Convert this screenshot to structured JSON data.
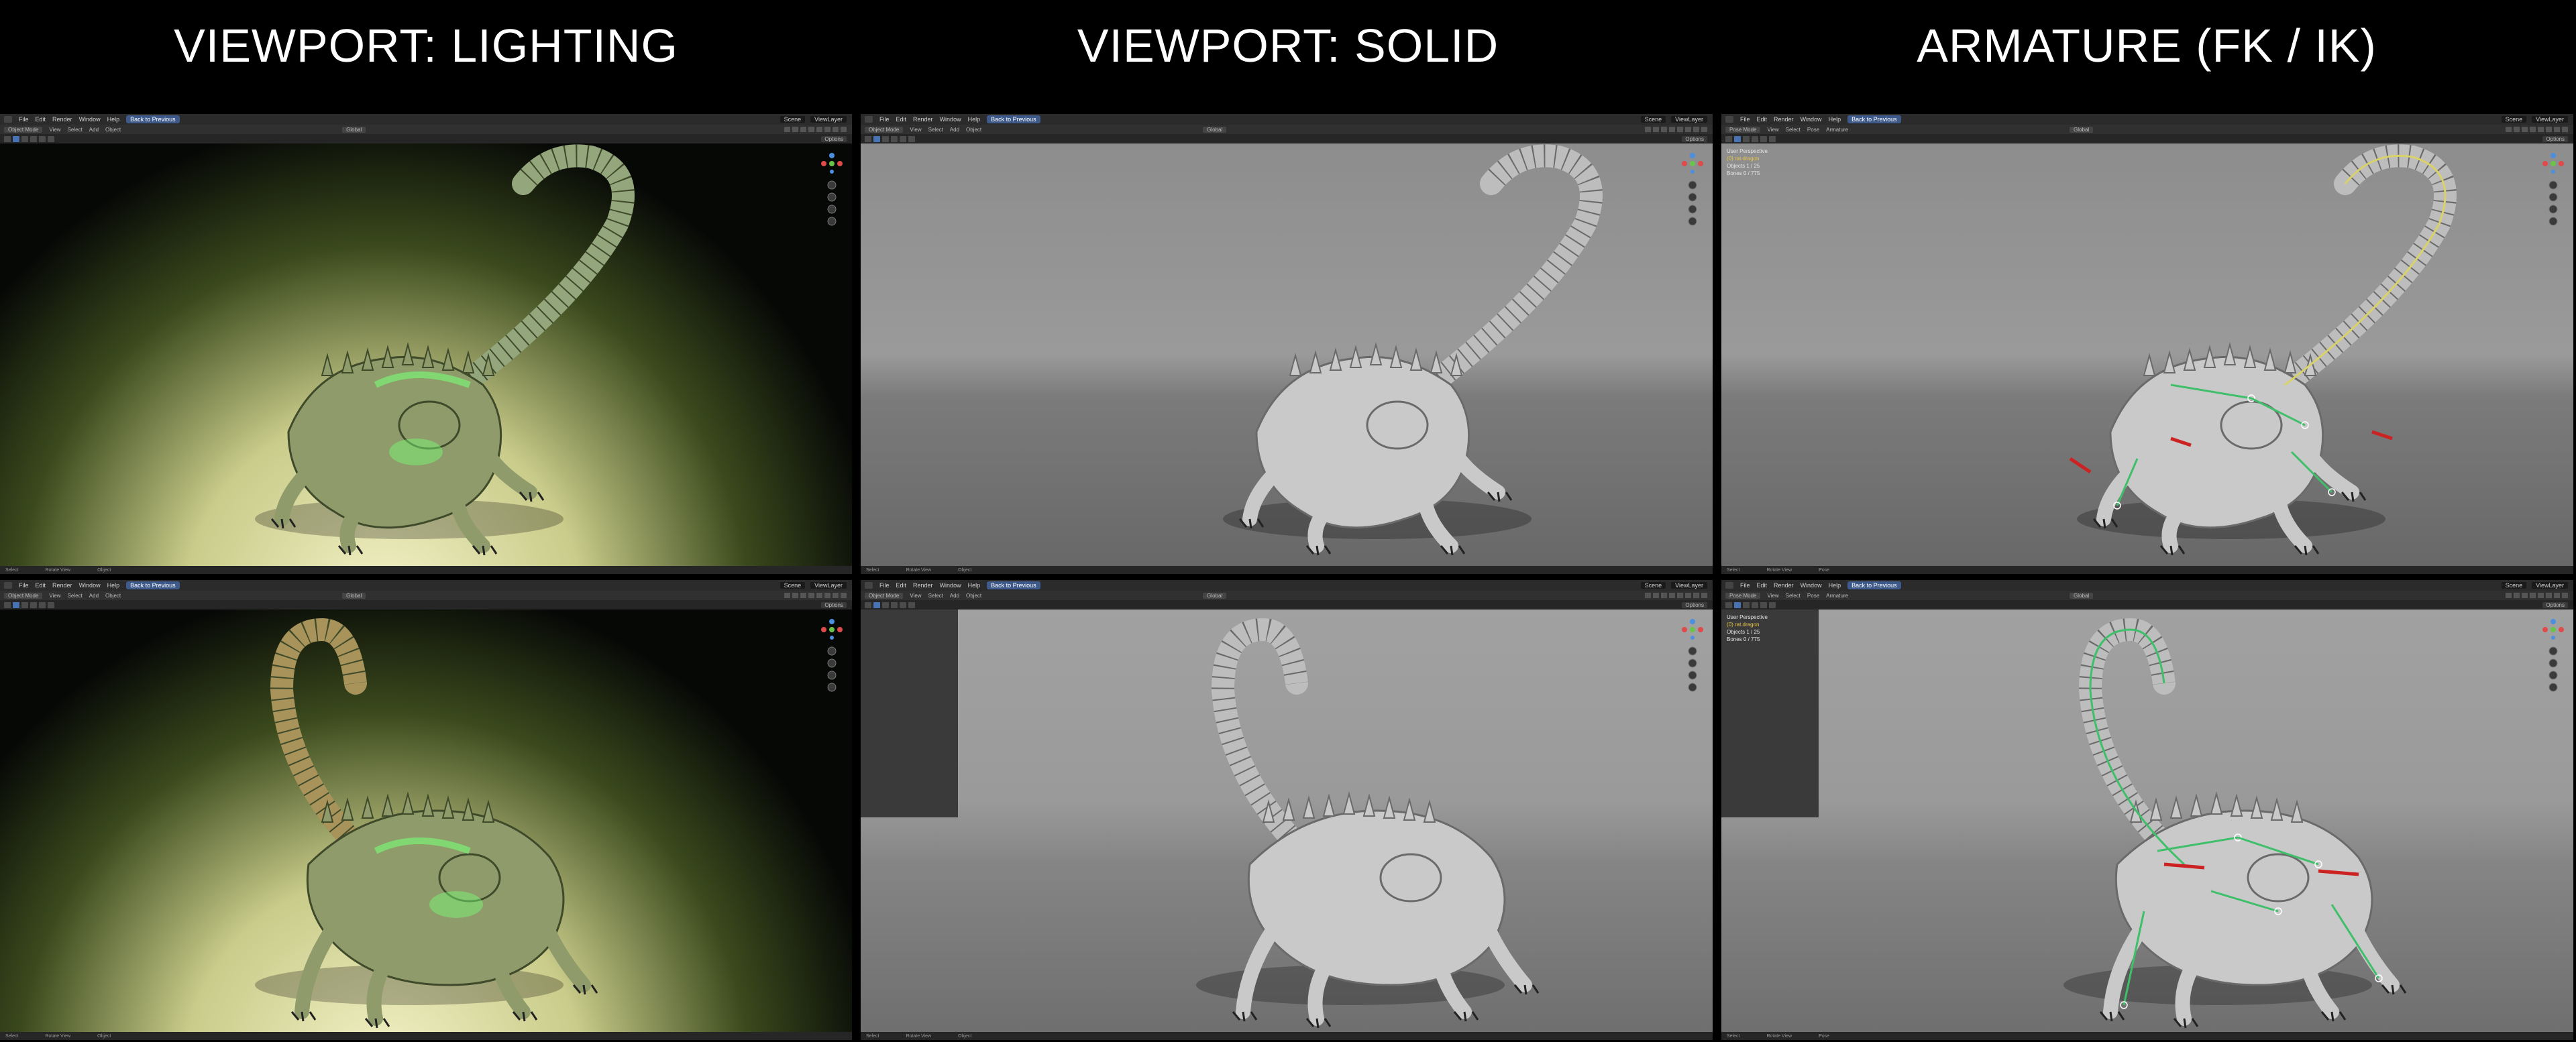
{
  "columns": [
    {
      "title": "VIEWPORT: LIGHTING"
    },
    {
      "title": "VIEWPORT: SOLID"
    },
    {
      "title": "ARMATURE (FK / IK)"
    }
  ],
  "menus": [
    "File",
    "Edit",
    "Render",
    "Window",
    "Help"
  ],
  "back_button": "Back to Previous",
  "scene_label": "Scene",
  "view_layer_label": "ViewLayer",
  "object_menus": [
    "View",
    "Select",
    "Add",
    "Object"
  ],
  "pose_menus": [
    "View",
    "Select",
    "Pose",
    "Armature"
  ],
  "object_mode": "Object Mode",
  "pose_mode": "Pose Mode",
  "orientation": "Global",
  "options_label": "Options",
  "status_left": "Select",
  "status_mid": "Rotate View",
  "status_object": "Object",
  "status_pose": "Pose",
  "overlay": {
    "perspective": "User Perspective",
    "object_name": "(0) rat.dragon",
    "objects": "Objects",
    "objects_val": "1 / 25",
    "bones": "Bones",
    "bones_val": "0 / 775"
  },
  "icons": {
    "axis_gizmo": "axis-gizmo-icon",
    "zoom": "zoom-icon",
    "hand": "hand-icon",
    "camera": "camera-icon",
    "grid": "grid-icon"
  },
  "colors": {
    "accent": "#4772b3",
    "x_axis": "#e04a4a",
    "y_axis": "#6cc34a",
    "z_axis": "#4a8fe0",
    "bone_green": "#3fbf6a",
    "bone_red": "#cc2222"
  }
}
